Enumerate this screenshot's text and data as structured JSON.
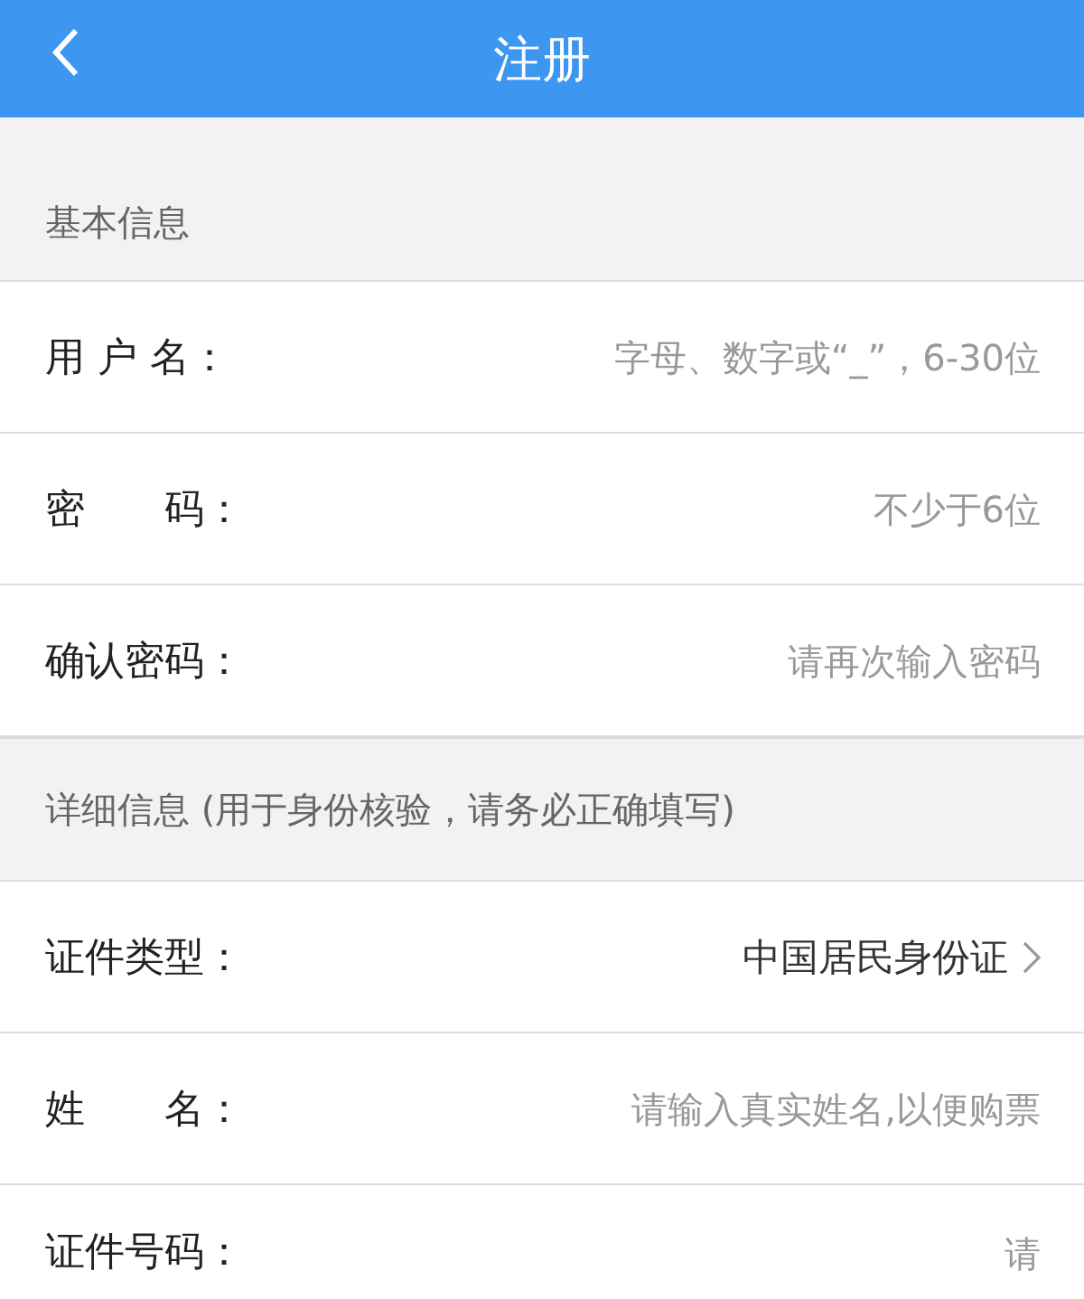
{
  "header": {
    "title": "注册"
  },
  "sections": [
    {
      "title": "基本信息",
      "rows": [
        {
          "kind": "input",
          "label": "用 户 名：",
          "placeholder": "字母、数字或“_”，6-30位"
        },
        {
          "kind": "input",
          "label": "密　　码：",
          "placeholder": "不少于6位"
        },
        {
          "kind": "input",
          "label": "确认密码：",
          "placeholder": "请再次输入密码"
        }
      ]
    },
    {
      "title": "详细信息 (用于身份核验，请务必正确填写)",
      "rows": [
        {
          "kind": "select",
          "label": "证件类型：",
          "value": "中国居民身份证"
        },
        {
          "kind": "input",
          "label": "姓　　名：",
          "placeholder": "请输入真实姓名,以便购票"
        },
        {
          "kind": "input",
          "label": "证件号码：",
          "placeholder": "请"
        }
      ]
    }
  ]
}
